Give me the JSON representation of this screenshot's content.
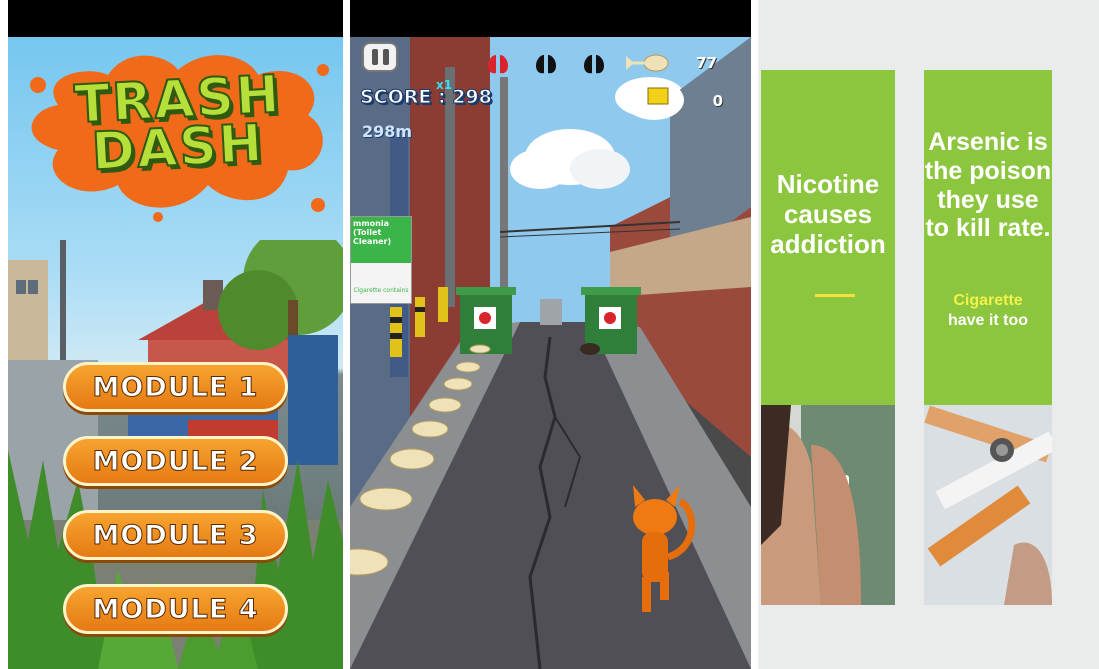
{
  "menu": {
    "title_line1": "TRASH",
    "title_line2": "DASH",
    "buttons": [
      "MODULE 1",
      "MODULE 2",
      "MODULE 3",
      "MODULE 4"
    ]
  },
  "game": {
    "score_label": "SCORE : 298",
    "multiplier": "x1",
    "distance": "298m",
    "fish_count": "77",
    "trash_count": "0",
    "sign_title": "mmonia (Toilet Cleaner)",
    "sign_footer": "Cigarette contains",
    "lives": [
      "red-lungs-icon",
      "black-lungs-icon",
      "black-lungs-icon"
    ]
  },
  "slides": {
    "card1_text": "Nicotine causes addiction",
    "card2_text": "Arsenic is the poison they use to kill rate.",
    "card2_sub1": "Cigarette",
    "card2_sub2": "have it too",
    "accent_green": "#8cc63f",
    "accent_yellow": "#f2f24a"
  }
}
